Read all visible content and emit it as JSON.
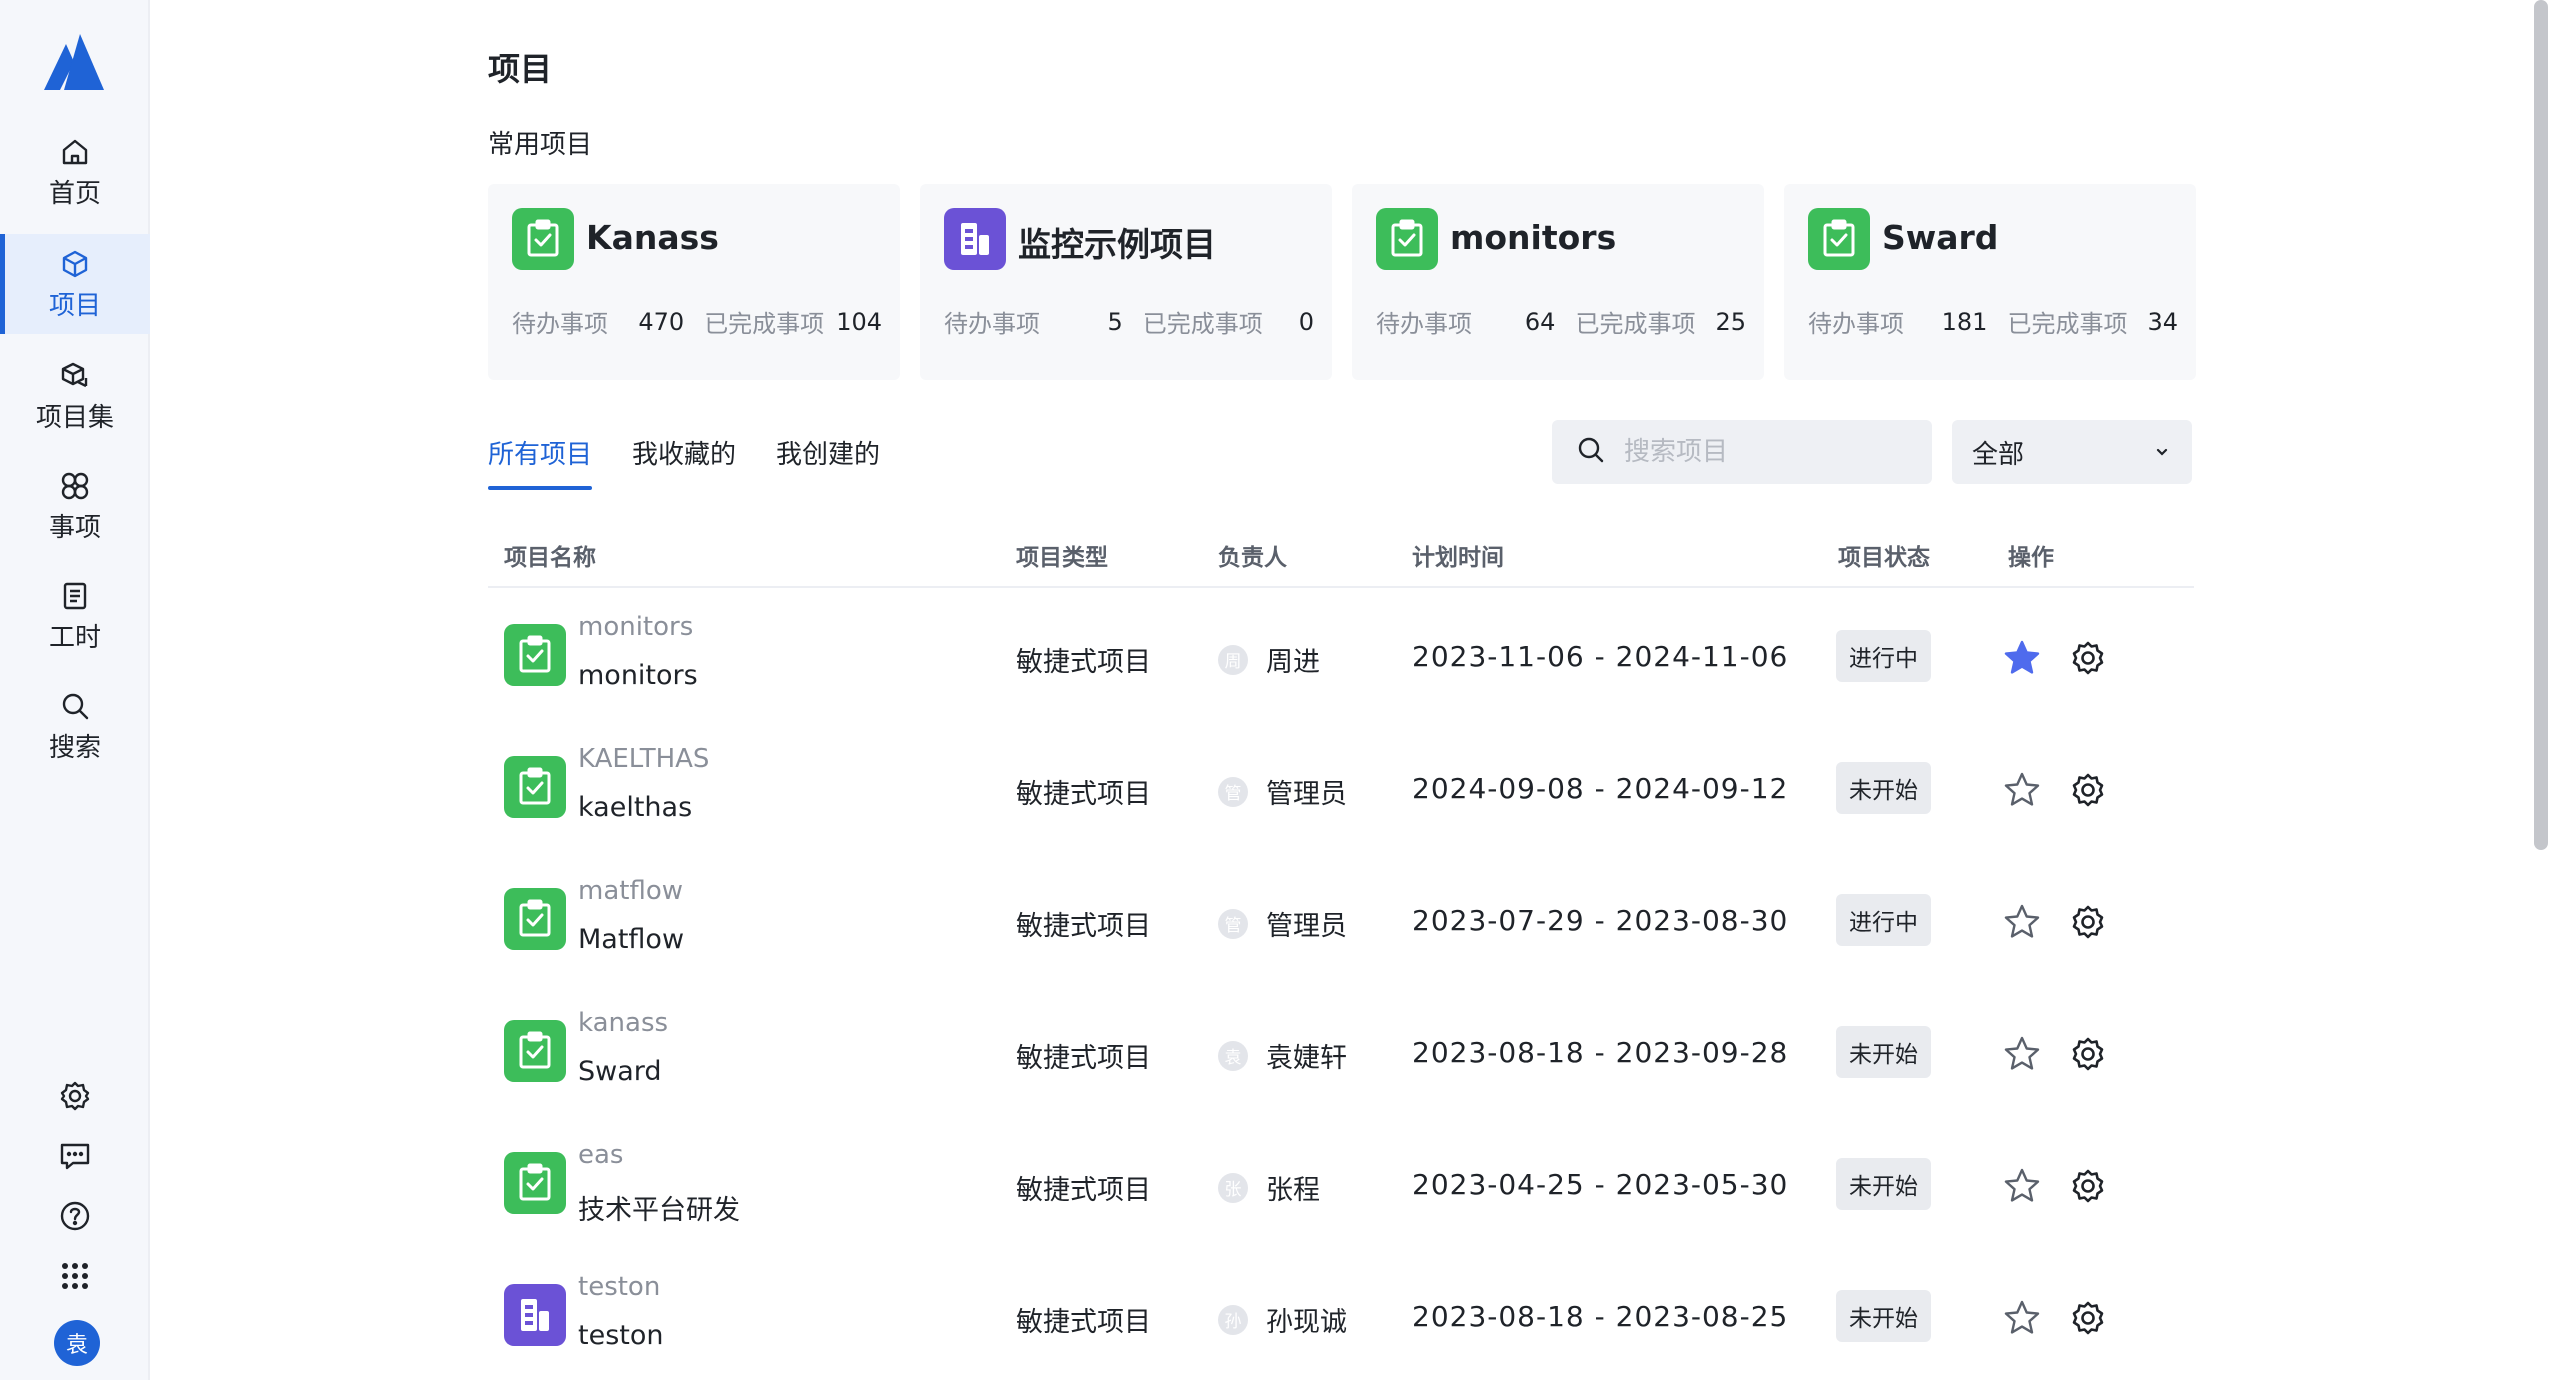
{
  "sidebar": {
    "items": [
      {
        "label": "首页",
        "icon": "home-icon"
      },
      {
        "label": "项目",
        "icon": "cube-icon"
      },
      {
        "label": "项目集",
        "icon": "cubes-icon"
      },
      {
        "label": "事项",
        "icon": "workitem-icon"
      },
      {
        "label": "工时",
        "icon": "clipboard-icon"
      },
      {
        "label": "搜索",
        "icon": "search-icon"
      }
    ],
    "avatar": "袁"
  },
  "page": {
    "title": "项目",
    "recent_title": "常用项目"
  },
  "recent": [
    {
      "name": "Kanass",
      "color": "green",
      "todo_label": "待办事项",
      "todo": "470",
      "done_label": "已完成事项",
      "done": "104"
    },
    {
      "name": "监控示例项目",
      "color": "purple",
      "todo_label": "待办事项",
      "todo": "5",
      "done_label": "已完成事项",
      "done": "0"
    },
    {
      "name": "monitors",
      "color": "green",
      "todo_label": "待办事项",
      "todo": "64",
      "done_label": "已完成事项",
      "done": "25"
    },
    {
      "name": "Sward",
      "color": "green",
      "todo_label": "待办事项",
      "todo": "181",
      "done_label": "已完成事项",
      "done": "34"
    }
  ],
  "tabs": [
    "所有项目",
    "我收藏的",
    "我创建的"
  ],
  "search": {
    "placeholder": "搜索项目"
  },
  "filter": {
    "value": "全部"
  },
  "table": {
    "headers": [
      "项目名称",
      "项目类型",
      "负责人",
      "计划时间",
      "项目状态",
      "操作"
    ],
    "rows": [
      {
        "key": "monitors",
        "name": "monitors",
        "type": "敏捷式项目",
        "owner_initial": "周",
        "owner": "周进",
        "time": "2023-11-06 - 2024-11-06",
        "status": "进行中",
        "starred": true,
        "color": "green"
      },
      {
        "key": "KAELTHAS",
        "name": "kaelthas",
        "type": "敏捷式项目",
        "owner_initial": "管",
        "owner": "管理员",
        "time": "2024-09-08 - 2024-09-12",
        "status": "未开始",
        "starred": false,
        "color": "green"
      },
      {
        "key": "matflow",
        "name": "Matflow",
        "type": "敏捷式项目",
        "owner_initial": "管",
        "owner": "管理员",
        "time": "2023-07-29 - 2023-08-30",
        "status": "进行中",
        "starred": false,
        "color": "green"
      },
      {
        "key": "kanass",
        "name": "Sward",
        "type": "敏捷式项目",
        "owner_initial": "袁",
        "owner": "袁婕轩",
        "time": "2023-08-18 - 2023-09-28",
        "status": "未开始",
        "starred": false,
        "color": "green"
      },
      {
        "key": "eas",
        "name": "技术平台研发",
        "type": "敏捷式项目",
        "owner_initial": "张",
        "owner": "张程",
        "time": "2023-04-25 - 2023-05-30",
        "status": "未开始",
        "starred": false,
        "color": "green"
      },
      {
        "key": "teston",
        "name": "teston",
        "type": "敏捷式项目",
        "owner_initial": "孙",
        "owner": "孙现诚",
        "time": "2023-08-18 - 2023-08-25",
        "status": "未开始",
        "starred": false,
        "color": "purple"
      }
    ]
  },
  "colors": {
    "accent": "#1f63d6",
    "green": "#3dbd5a",
    "purple": "#6b52d6",
    "star": "#4f6bed"
  }
}
